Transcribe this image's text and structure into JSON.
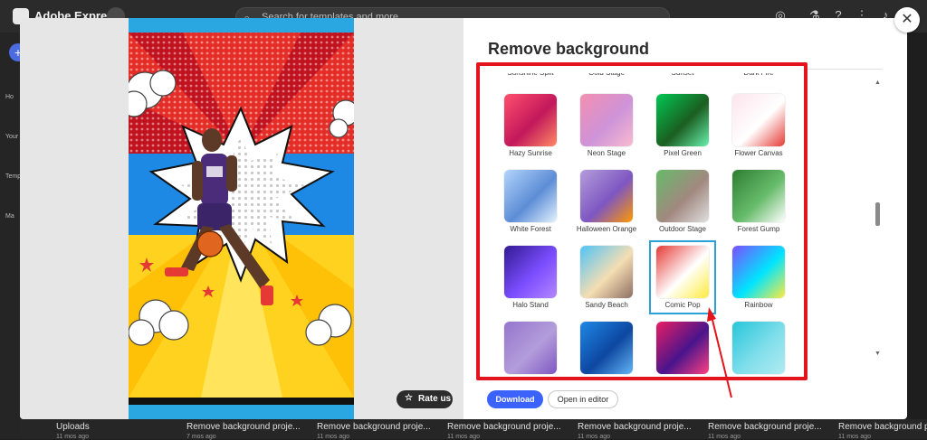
{
  "app": {
    "title": "Adobe Express"
  },
  "search": {
    "placeholder": "Search for templates and more"
  },
  "sidebar": {
    "items": [
      "Ho",
      "Your",
      "Temp",
      "Ma"
    ]
  },
  "modal": {
    "title": "Remove background",
    "rate_label": "Rate us",
    "download_label": "Download",
    "open_editor_label": "Open in editor",
    "close_symbol": "✕"
  },
  "backgrounds": {
    "partial_top_labels": [
      "Sunshine Split",
      "Gold Stage",
      "Sunset",
      "Dark Fire"
    ],
    "items": [
      {
        "label": "Hazy Sunrise",
        "colors": [
          "#ff4f6d",
          "#c2185b",
          "#ff8a65"
        ]
      },
      {
        "label": "Neon Stage",
        "colors": [
          "#f48fb1",
          "#ce93d8",
          "#f8bbd0"
        ]
      },
      {
        "label": "Pixel Green",
        "colors": [
          "#00c853",
          "#1b5e20",
          "#69f0ae"
        ]
      },
      {
        "label": "Flower Canvas",
        "colors": [
          "#fce4ec",
          "#ffffff",
          "#e53935"
        ]
      },
      {
        "label": "White Forest",
        "colors": [
          "#b3d4fc",
          "#5c8dd6",
          "#e3f2fd"
        ]
      },
      {
        "label": "Halloween Orange",
        "colors": [
          "#b39ddb",
          "#7e57c2",
          "#ff9800"
        ]
      },
      {
        "label": "Outdoor Stage",
        "colors": [
          "#66bb6a",
          "#a1887f",
          "#e0e0e0"
        ]
      },
      {
        "label": "Forest Gump",
        "colors": [
          "#2e7d32",
          "#66bb6a",
          "#ffffff"
        ]
      },
      {
        "label": "Halo Stand",
        "colors": [
          "#311b92",
          "#7c4dff",
          "#b388ff"
        ]
      },
      {
        "label": "Sandy Beach",
        "colors": [
          "#4fc3f7",
          "#f5deb3",
          "#8d6e63"
        ]
      },
      {
        "label": "Comic Pop",
        "colors": [
          "#e53935",
          "#ffffff",
          "#ffeb3b"
        ]
      },
      {
        "label": "Rainbow",
        "colors": [
          "#7c4dff",
          "#00e5ff",
          "#ffeb3b"
        ]
      },
      {
        "label": "",
        "colors": [
          "#9575cd",
          "#b39ddb",
          "#7e57c2"
        ]
      },
      {
        "label": "",
        "colors": [
          "#1e88e5",
          "#0d47a1",
          "#64b5f6"
        ]
      },
      {
        "label": "",
        "colors": [
          "#e91e63",
          "#4a148c",
          "#ff4081"
        ]
      },
      {
        "label": "",
        "colors": [
          "#26c6da",
          "#80deea",
          "#b2ebf2"
        ]
      }
    ],
    "selected": "Comic Pop"
  },
  "recent": {
    "items": [
      {
        "label": "Uploads",
        "sub": "11 mos ago"
      },
      {
        "label": "Remove background proje...",
        "sub": "7 mos ago"
      },
      {
        "label": "Remove background proje...",
        "sub": "11 mos ago"
      },
      {
        "label": "Remove background proje...",
        "sub": "11 mos ago"
      },
      {
        "label": "Remove background proje...",
        "sub": "11 mos ago"
      },
      {
        "label": "Remove background proje...",
        "sub": "11 mos ago"
      },
      {
        "label": "Remove background proje...",
        "sub": "11 mos ago"
      }
    ]
  },
  "colors": {
    "accent": "#3b63fb",
    "highlight": "#e3141b",
    "selection": "#2ba2d7"
  }
}
